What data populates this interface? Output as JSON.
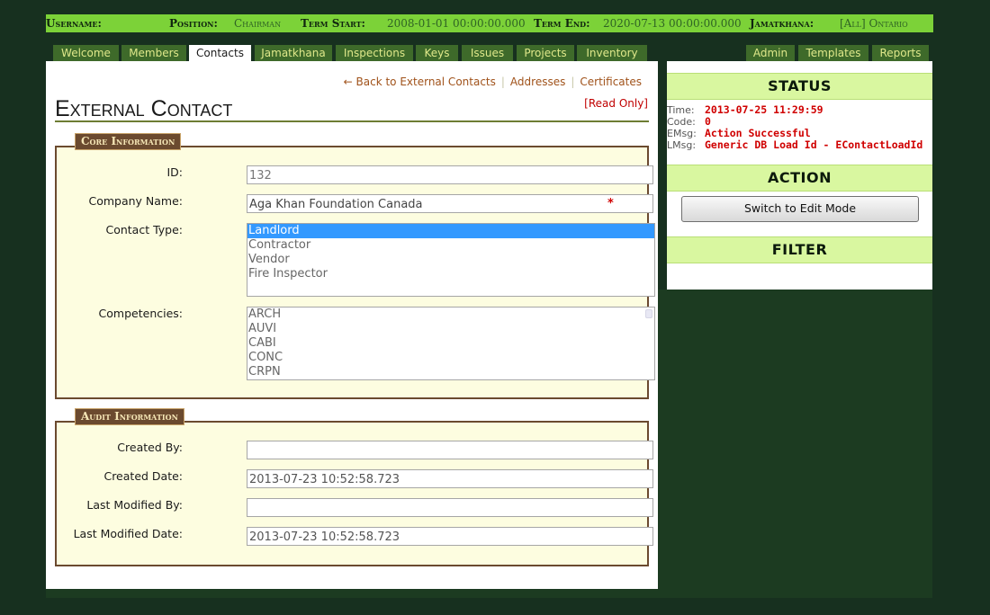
{
  "topbar": {
    "username_label": "Username:",
    "username_value": "",
    "position_label": "Position:",
    "position_value": "Chairman",
    "term_start_label": "Term Start:",
    "term_start_value": "2008-01-01 00:00:00.000",
    "term_end_label": "Term End:",
    "term_end_value": "2020-07-13 00:00:00.000",
    "jamatkhana_label": "Jamatkhana:",
    "jamatkhana_value": "[All] Ontario"
  },
  "tabs": {
    "left": [
      "Welcome",
      "Members",
      "Contacts",
      "Jamatkhana",
      "Inspections",
      "Keys",
      "Issues",
      "Projects",
      "Inventory"
    ],
    "right": [
      "Admin",
      "Templates",
      "Reports"
    ],
    "active": "Contacts"
  },
  "links": {
    "back": "← Back to External Contacts",
    "addresses": "Addresses",
    "certificates": "Certificates"
  },
  "read_only": "[Read Only]",
  "page_title": "External Contact",
  "core": {
    "legend": "Core Information",
    "id_label": "ID:",
    "id_value": "132",
    "company_label": "Company Name:",
    "company_value": "Aga Khan Foundation Canada",
    "required_mark": "*",
    "contact_type_label": "Contact Type:",
    "contact_types": [
      "Landlord",
      "Contractor",
      "Vendor",
      "Fire Inspector"
    ],
    "contact_type_selected": "Landlord",
    "competencies_label": "Competencies:",
    "competencies": [
      "ARCH",
      "AUVI",
      "CABI",
      "CONC",
      "CRPN"
    ]
  },
  "audit": {
    "legend": "Audit Information",
    "created_by_label": "Created By:",
    "created_by_value": "",
    "created_date_label": "Created Date:",
    "created_date_value": "2013-07-23 10:52:58.723",
    "modified_by_label": "Last Modified By:",
    "modified_by_value": "",
    "modified_date_label": "Last Modified Date:",
    "modified_date_value": "2013-07-23 10:52:58.723"
  },
  "status": {
    "heading": "STATUS",
    "time_label": "Time:",
    "time_value": "2013-07-25 11:29:59",
    "code_label": "Code:",
    "code_value": "0",
    "emsg_label": "EMsg:",
    "emsg_value": "Action Successful",
    "lmsg_label": "LMsg:",
    "lmsg_value": "Generic DB Load Id - EContactLoadId"
  },
  "action": {
    "heading": "ACTION",
    "button": "Switch to Edit Mode"
  },
  "filter": {
    "heading": "FILTER"
  },
  "colors": {
    "topbar": "#7cd238",
    "tab_bg": "#3e6a2a",
    "background": "#17301f",
    "legend_bg": "#6b4a2f",
    "panel_band": "#d9f7a0",
    "status_value": "#d00000"
  }
}
